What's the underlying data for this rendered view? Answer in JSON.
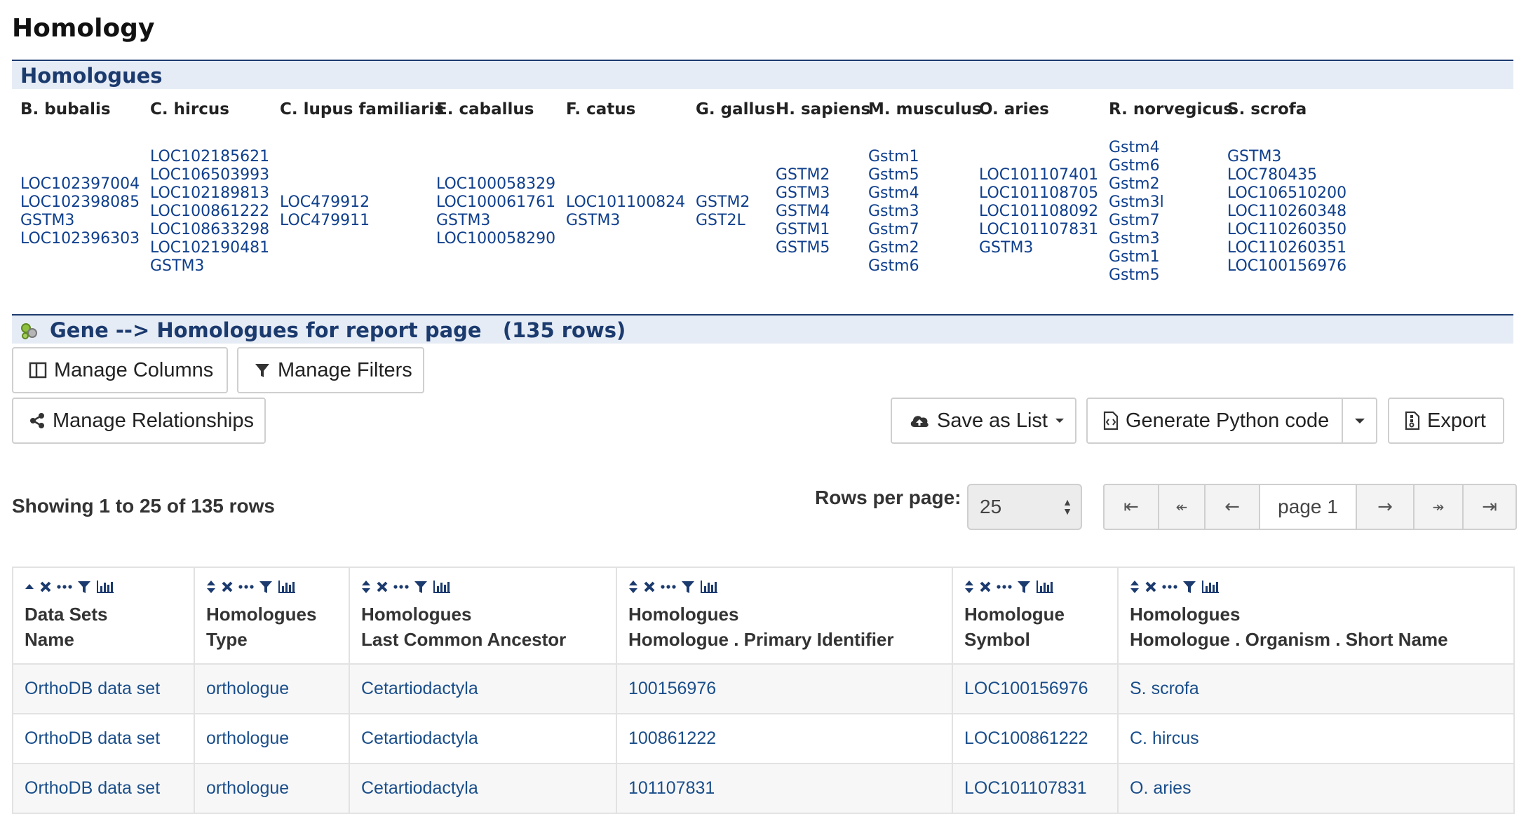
{
  "page": {
    "title": "Homology"
  },
  "homologues_section": {
    "title": "Homologues",
    "organisms": [
      {
        "name": "B. bubalis",
        "genes": [
          "LOC102397004",
          "LOC102398085",
          "GSTM3",
          "LOC102396303"
        ]
      },
      {
        "name": "C. hircus",
        "genes": [
          "LOC102185621",
          "LOC106503993",
          "LOC102189813",
          "LOC100861222",
          "LOC108633298",
          "LOC102190481",
          "GSTM3"
        ]
      },
      {
        "name": "C. lupus familiaris",
        "genes": [
          "LOC479912",
          "LOC479911"
        ]
      },
      {
        "name": "E. caballus",
        "genes": [
          "LOC100058329",
          "LOC100061761",
          "GSTM3",
          "LOC100058290"
        ]
      },
      {
        "name": "F. catus",
        "genes": [
          "LOC101100824",
          "GSTM3"
        ]
      },
      {
        "name": "G. gallus",
        "genes": [
          "GSTM2",
          "GST2L"
        ]
      },
      {
        "name": "H. sapiens",
        "genes": [
          "GSTM2",
          "GSTM3",
          "GSTM4",
          "GSTM1",
          "GSTM5"
        ]
      },
      {
        "name": "M. musculus",
        "genes": [
          "Gstm1",
          "Gstm5",
          "Gstm4",
          "Gstm3",
          "Gstm7",
          "Gstm2",
          "Gstm6"
        ]
      },
      {
        "name": "O. aries",
        "genes": [
          "LOC101107401",
          "LOC101108705",
          "LOC101108092",
          "LOC101107831",
          "GSTM3"
        ]
      },
      {
        "name": "R. norvegicus",
        "genes": [
          "Gstm4",
          "Gstm6",
          "Gstm2",
          "Gstm3l",
          "Gstm7",
          "Gstm3",
          "Gstm1",
          "Gstm5"
        ]
      },
      {
        "name": "S. scrofa",
        "genes": [
          "GSTM3",
          "LOC780435",
          "LOC106510200",
          "LOC110260348",
          "LOC110260350",
          "LOC110260351",
          "LOC100156976"
        ]
      }
    ]
  },
  "gene_section": {
    "title": "Gene --> Homologues for report page   (135 rows)",
    "icon": "gear-cluster-icon"
  },
  "toolbar": {
    "manage_columns": "Manage Columns",
    "manage_filters": "Manage Filters",
    "manage_relationships": "Manage Relationships",
    "save_as_list": "Save as List",
    "generate_python": "Generate Python code",
    "export": "Export"
  },
  "pagination": {
    "showing": "Showing 1 to 25 of 135 rows",
    "rows_per_page_label": "Rows per page:",
    "rows_per_page_value": "25",
    "current_page": "page 1"
  },
  "table": {
    "columns": [
      {
        "line1": "Data Sets",
        "line2": "Name",
        "sort": "up"
      },
      {
        "line1": "Homologues",
        "line2": "Type",
        "sort": "both"
      },
      {
        "line1": "Homologues",
        "line2": "Last Common Ancestor",
        "sort": "both"
      },
      {
        "line1": "Homologues",
        "line2": "Homologue . Primary Identifier",
        "sort": "both"
      },
      {
        "line1": "Homologue",
        "line2": "Symbol",
        "sort": "both"
      },
      {
        "line1": "Homologues",
        "line2": "Homologue . Organism . Short Name",
        "sort": "both"
      }
    ],
    "rows": [
      [
        "OrthoDB data set",
        "orthologue",
        "Cetartiodactyla",
        "100156976",
        "LOC100156976",
        "S. scrofa"
      ],
      [
        "OrthoDB data set",
        "orthologue",
        "Cetartiodactyla",
        "100861222",
        "LOC100861222",
        "C. hircus"
      ],
      [
        "OrthoDB data set",
        "orthologue",
        "Cetartiodactyla",
        "101107831",
        "LOC101107831",
        "O. aries"
      ]
    ]
  },
  "colors": {
    "accent": "#1b3a6e",
    "link": "#0f3f8c",
    "bar_bg": "#e6ecf5"
  }
}
